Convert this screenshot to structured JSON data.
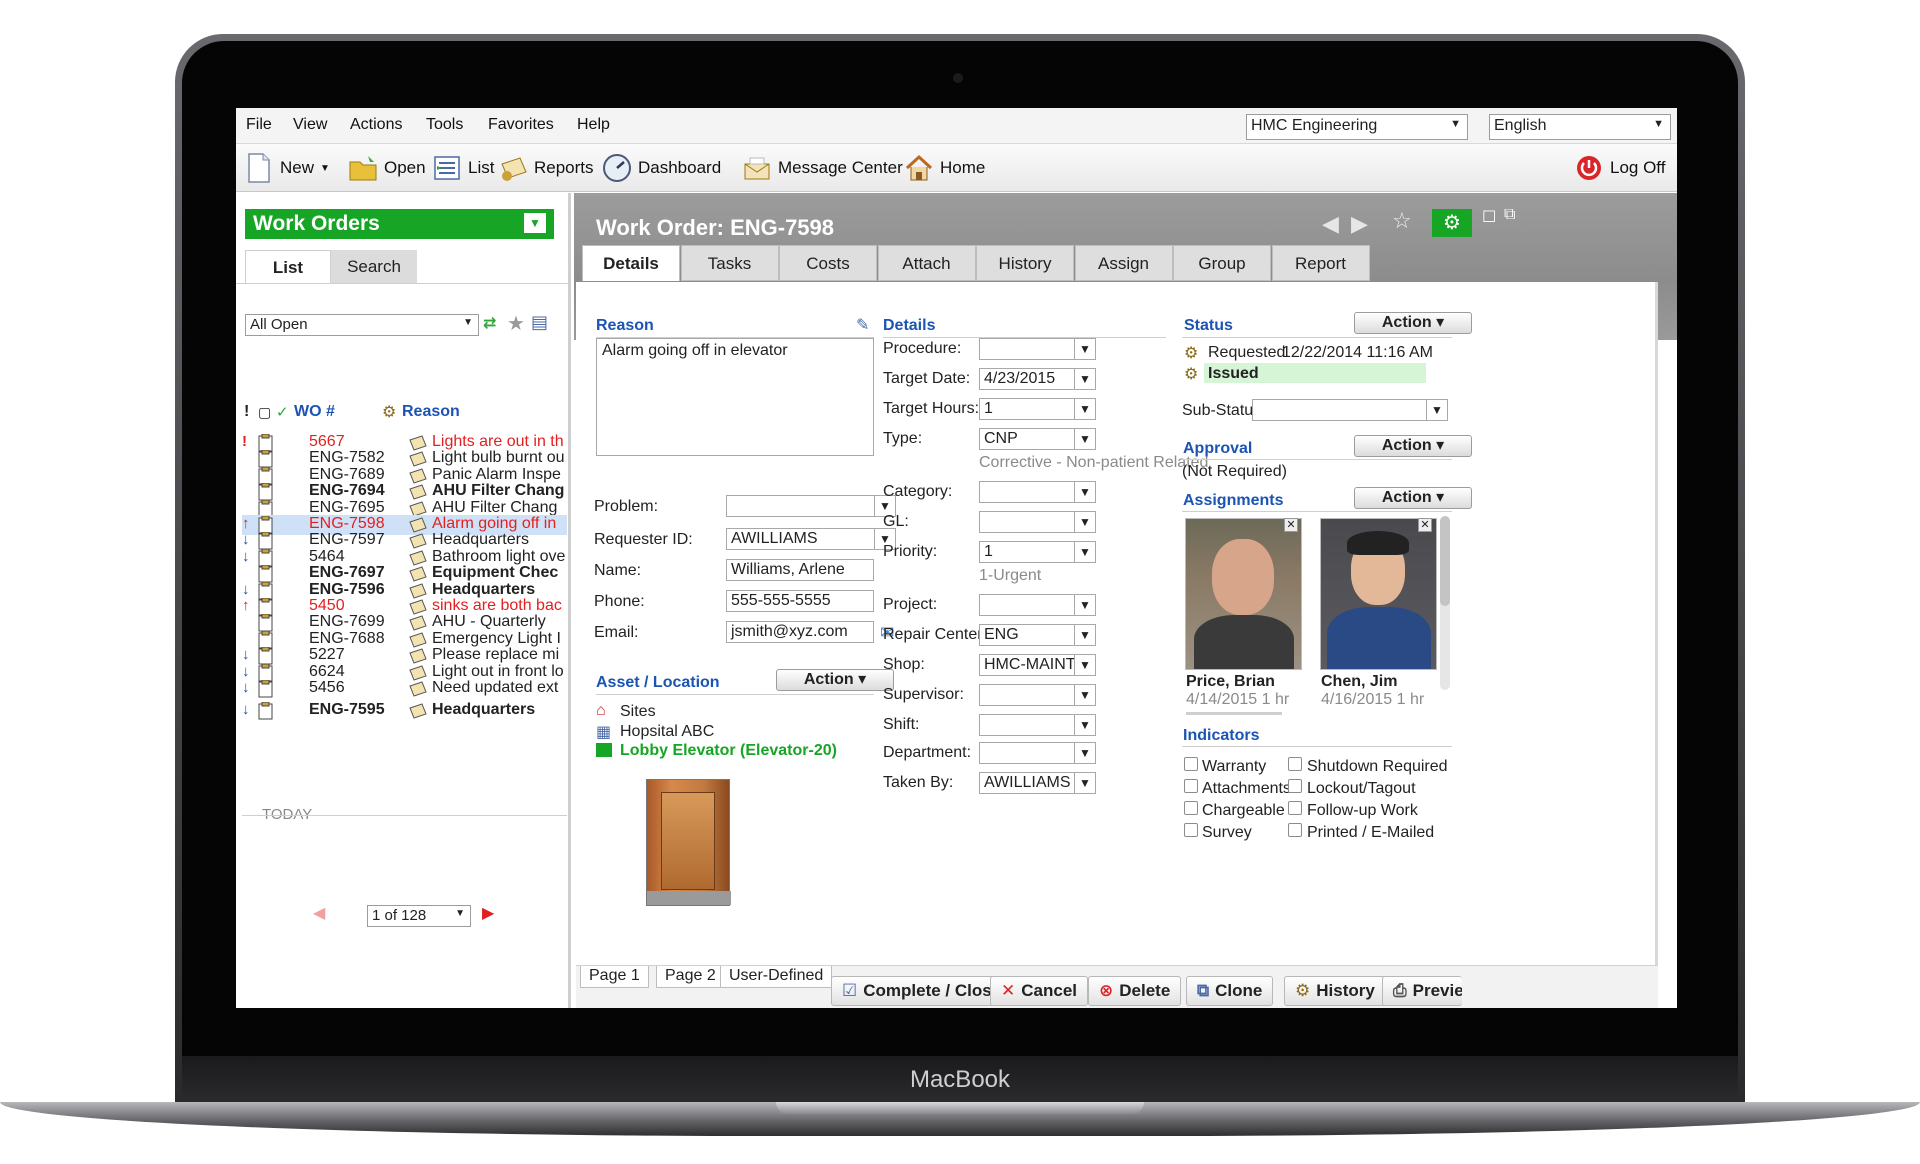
{
  "device": {
    "brand": "MacBook"
  },
  "menu": {
    "items": [
      "File",
      "View",
      "Actions",
      "Tools",
      "Favorites",
      "Help"
    ],
    "company": "HMC Engineering",
    "language": "English"
  },
  "toolbar": {
    "new": "New",
    "open": "Open",
    "list": "List",
    "reports": "Reports",
    "dashboard": "Dashboard",
    "message_center": "Message Center",
    "home": "Home",
    "logoff": "Log Off"
  },
  "left": {
    "title": "Work Orders",
    "tabs": [
      "List",
      "Search"
    ],
    "filter": "All Open",
    "col_wo": "WO #",
    "col_reason": "Reason",
    "rows": [
      {
        "flag": "!",
        "num": "5667",
        "reason": "Lights are out in th",
        "style": "red"
      },
      {
        "flag": "",
        "num": "ENG-7582",
        "reason": "Light bulb burnt ou",
        "style": ""
      },
      {
        "flag": "",
        "num": "ENG-7689",
        "reason": "Panic Alarm Inspe",
        "style": ""
      },
      {
        "flag": "",
        "num": "ENG-7694",
        "reason": "AHU Filter Chang",
        "style": "bold"
      },
      {
        "flag": "",
        "num": "ENG-7695",
        "reason": "AHU Filter Chang",
        "style": ""
      },
      {
        "flag": "↑",
        "num": "ENG-7598",
        "reason": "Alarm going off in",
        "style": "red selected"
      },
      {
        "flag": "↓",
        "num": "ENG-7597",
        "reason": "Headquarters",
        "style": ""
      },
      {
        "flag": "↓",
        "num": "5464",
        "reason": "Bathroom light ove",
        "style": ""
      },
      {
        "flag": "",
        "num": "ENG-7697",
        "reason": "Equipment Chec",
        "style": "bold"
      },
      {
        "flag": "↓",
        "num": "ENG-7596",
        "reason": "Headquarters",
        "style": "bold"
      },
      {
        "flag": "↑",
        "num": "5450",
        "reason": "sinks are both bac",
        "style": "red"
      },
      {
        "flag": "",
        "num": "ENG-7699",
        "reason": "AHU - Quarterly",
        "style": ""
      },
      {
        "flag": "",
        "num": "ENG-7688",
        "reason": "Emergency Light I",
        "style": ""
      },
      {
        "flag": "↓",
        "num": "5227",
        "reason": "Please replace mi",
        "style": ""
      },
      {
        "flag": "↓",
        "num": "6624",
        "reason": "Light out in front lo",
        "style": ""
      },
      {
        "flag": "↓",
        "num": "5456",
        "reason": "Need updated ext",
        "style": ""
      }
    ],
    "today_label": "TODAY",
    "today_row": {
      "flag": "↓",
      "num": "ENG-7595",
      "reason": "Headquarters",
      "style": "bold"
    },
    "pager": "1 of 128"
  },
  "main": {
    "title": "Work Order: ENG-7598",
    "tabs": [
      "Details",
      "Tasks",
      "Costs",
      "Attach",
      "History",
      "Assign",
      "Group",
      "Report"
    ],
    "reason": {
      "title": "Reason",
      "text": "Alarm going off in elevator"
    },
    "problem_label": "Problem:",
    "problem_value": "",
    "requester_label": "Requester ID:",
    "requester_value": "AWILLIAMS",
    "name_label": "Name:",
    "name_value": "Williams, Arlene",
    "phone_label": "Phone:",
    "phone_value": "555-555-5555",
    "email_label": "Email:",
    "email_value": "jsmith@xyz.com",
    "asset": {
      "title": "Asset / Location",
      "action": "Action",
      "sites": "Sites",
      "site": "Hopsital ABC",
      "equipment": "Lobby Elevator (Elevator-20)"
    },
    "details": {
      "title": "Details",
      "procedure_label": "Procedure:",
      "procedure_value": "",
      "target_date_label": "Target Date:",
      "target_date_value": "4/23/2015",
      "target_hours_label": "Target Hours:",
      "target_hours_value": "1",
      "type_label": "Type:",
      "type_value": "CNP",
      "type_hint": "Corrective - Non-patient Related",
      "category_label": "Category:",
      "category_value": "",
      "gl_label": "GL:",
      "gl_value": "",
      "priority_label": "Priority:",
      "priority_value": "1",
      "priority_hint": "1-Urgent",
      "project_label": "Project:",
      "project_value": "",
      "repair_center_label": "Repair Center:",
      "repair_center_value": "ENG",
      "shop_label": "Shop:",
      "shop_value": "HMC-MAINT-SH",
      "supervisor_label": "Supervisor:",
      "supervisor_value": "",
      "shift_label": "Shift:",
      "shift_value": "",
      "department_label": "Department:",
      "department_value": "",
      "taken_by_label": "Taken By:",
      "taken_by_value": "AWILLIAMS"
    },
    "status": {
      "title": "Status",
      "action": "Action",
      "requested_label": "Requested",
      "requested_date": "12/22/2014 11:16 AM",
      "issued": "Issued",
      "substatus_label": "Sub-Status:"
    },
    "approval": {
      "title": "Approval",
      "action": "Action",
      "value": "(Not Required)"
    },
    "assignments": {
      "title": "Assignments",
      "action": "Action",
      "people": [
        {
          "name": "Price, Brian",
          "detail": "4/14/2015 1 hr"
        },
        {
          "name": "Chen, Jim",
          "detail": "4/16/2015 1 hr"
        }
      ]
    },
    "indicators": {
      "title": "Indicators",
      "left": [
        "Warranty",
        "Attachments",
        "Chargeable",
        "Survey"
      ],
      "right": [
        "Shutdown Required",
        "Lockout/Tagout",
        "Follow-up Work",
        "Printed / E-Mailed"
      ]
    },
    "page_tabs": [
      "Page 1",
      "Page 2",
      "User-Defined"
    ],
    "buttons": {
      "complete": "Complete / Close",
      "cancel": "Cancel",
      "delete": "Delete",
      "clone": "Clone",
      "history": "History",
      "preview": "Previe"
    }
  }
}
